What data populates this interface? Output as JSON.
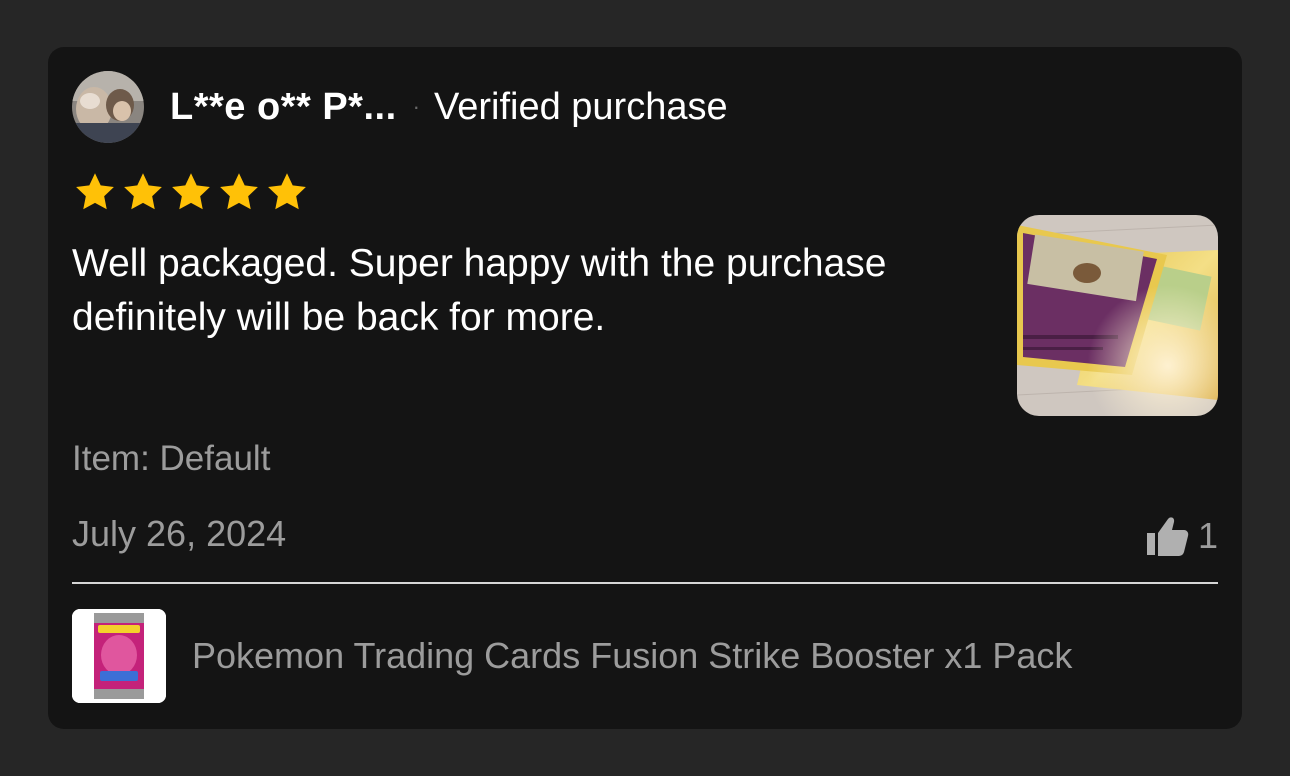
{
  "review": {
    "reviewer_name": "L**e o** P*...",
    "separator": "·",
    "verified_label": "Verified purchase",
    "rating": 5,
    "rating_max": 5,
    "star_color": "#FFC107",
    "text": "Well packaged. Super happy with the purchase definitely will be back for more.",
    "item_variant": "Item: Default",
    "date": "July 26, 2024",
    "helpful_icon": "thumbs-up-icon",
    "helpful_count": "1"
  },
  "product": {
    "title": "Pokemon Trading Cards Fusion Strike Booster x1 Pack"
  },
  "colors": {
    "page_background": "#262626",
    "card_background": "#141414",
    "secondary_text": "#9C9C9C"
  }
}
